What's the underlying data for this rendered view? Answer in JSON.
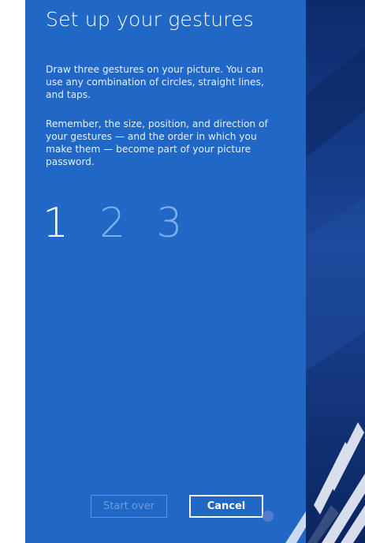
{
  "dialog": {
    "title": "Set up your gestures",
    "instructions": "Draw three gestures on your picture. You can use any combination of circles, straight lines, and taps.",
    "reminder": "Remember, the size, position, and direction of your gestures — and the order in which you make them — become part of your picture password.",
    "steps": [
      "1",
      "2",
      "3"
    ],
    "current_step": 1,
    "start_over_label": "Start over",
    "cancel_label": "Cancel"
  },
  "colors": {
    "panel_background": "#2167c6",
    "picture_background": "#163c8c",
    "inactive_step": "#7fb1ea"
  }
}
